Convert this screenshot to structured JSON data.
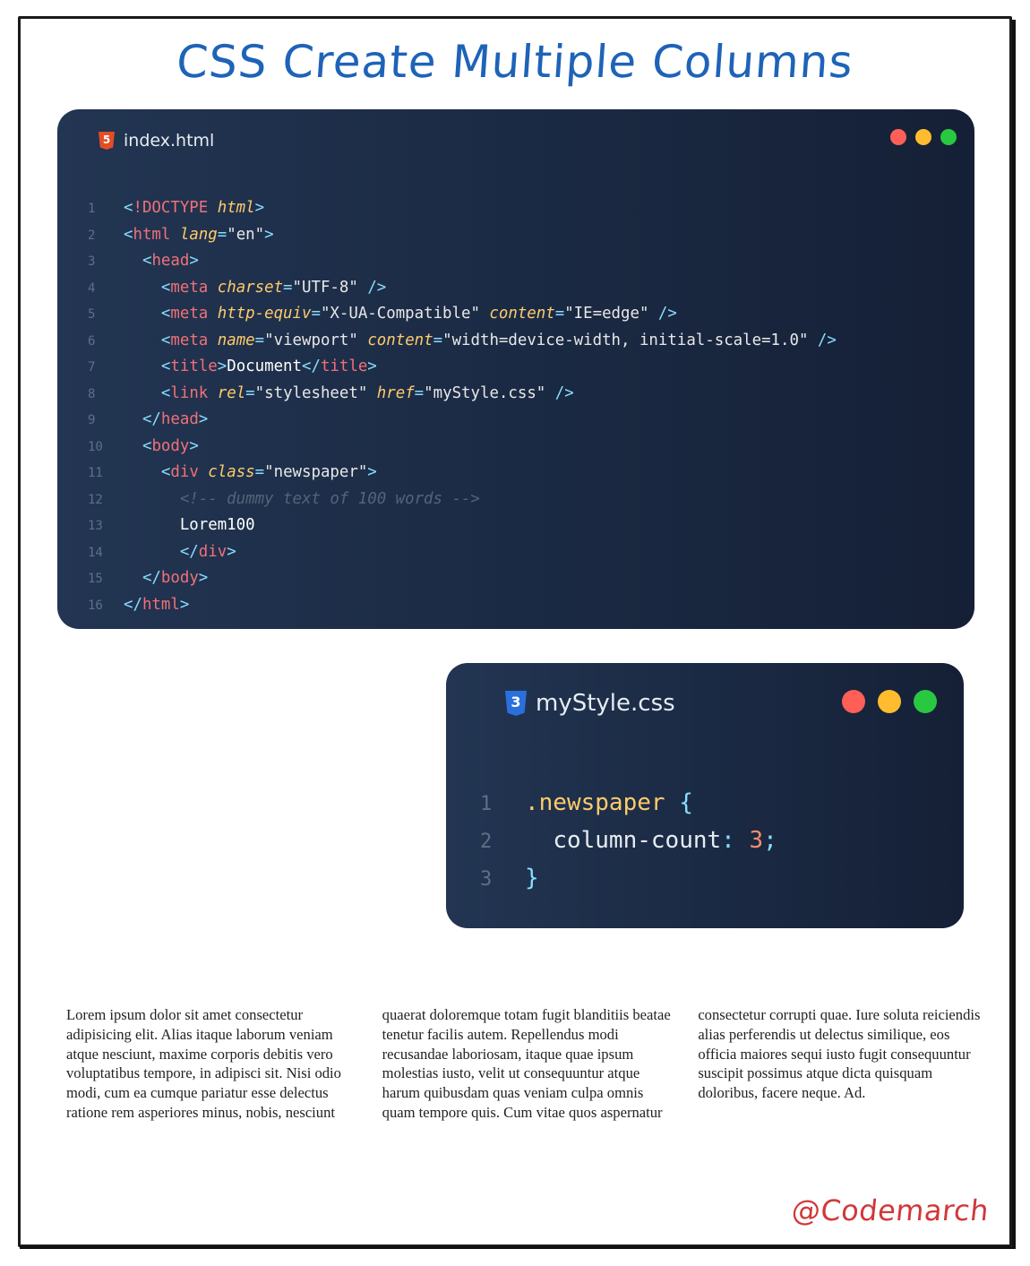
{
  "title": "CSS Create Multiple Columns",
  "html_window": {
    "filename": "index.html",
    "icon": "html5-icon",
    "lines": [
      {
        "n": "1",
        "indent": 0,
        "tokens": [
          [
            "punc",
            "<"
          ],
          [
            "tag",
            "!DOCTYPE"
          ],
          [
            "txt",
            " "
          ],
          [
            "attr",
            "html"
          ],
          [
            "punc",
            ">"
          ]
        ]
      },
      {
        "n": "2",
        "indent": 0,
        "tokens": [
          [
            "punc",
            "<"
          ],
          [
            "tag",
            "html"
          ],
          [
            "txt",
            " "
          ],
          [
            "attr",
            "lang"
          ],
          [
            "eq",
            "="
          ],
          [
            "str",
            "\"en\""
          ],
          [
            "punc",
            ">"
          ]
        ]
      },
      {
        "n": "3",
        "indent": 1,
        "tokens": [
          [
            "punc",
            "<"
          ],
          [
            "tag",
            "head"
          ],
          [
            "punc",
            ">"
          ]
        ]
      },
      {
        "n": "4",
        "indent": 2,
        "tokens": [
          [
            "punc",
            "<"
          ],
          [
            "tag",
            "meta"
          ],
          [
            "txt",
            " "
          ],
          [
            "attr",
            "charset"
          ],
          [
            "eq",
            "="
          ],
          [
            "str",
            "\"UTF-8\""
          ],
          [
            "txt",
            " "
          ],
          [
            "punc",
            "/>"
          ]
        ]
      },
      {
        "n": "5",
        "indent": 2,
        "tokens": [
          [
            "punc",
            "<"
          ],
          [
            "tag",
            "meta"
          ],
          [
            "txt",
            " "
          ],
          [
            "attr",
            "http-equiv"
          ],
          [
            "eq",
            "="
          ],
          [
            "str",
            "\"X-UA-Compatible\""
          ],
          [
            "txt",
            " "
          ],
          [
            "attr",
            "content"
          ],
          [
            "eq",
            "="
          ],
          [
            "str",
            "\"IE=edge\""
          ],
          [
            "txt",
            " "
          ],
          [
            "punc",
            "/>"
          ]
        ]
      },
      {
        "n": "6",
        "indent": 2,
        "tokens": [
          [
            "punc",
            "<"
          ],
          [
            "tag",
            "meta"
          ],
          [
            "txt",
            " "
          ],
          [
            "attr",
            "name"
          ],
          [
            "eq",
            "="
          ],
          [
            "str",
            "\"viewport\""
          ],
          [
            "txt",
            " "
          ],
          [
            "attr",
            "content"
          ],
          [
            "eq",
            "="
          ],
          [
            "str",
            "\"width=device-width, initial-scale=1.0\""
          ],
          [
            "txt",
            " "
          ],
          [
            "punc",
            "/>"
          ]
        ]
      },
      {
        "n": "7",
        "indent": 2,
        "tokens": [
          [
            "punc",
            "<"
          ],
          [
            "tag",
            "title"
          ],
          [
            "punc",
            ">"
          ],
          [
            "txt",
            "Document"
          ],
          [
            "punc",
            "</"
          ],
          [
            "tag",
            "title"
          ],
          [
            "punc",
            ">"
          ]
        ]
      },
      {
        "n": "8",
        "indent": 2,
        "tokens": [
          [
            "punc",
            "<"
          ],
          [
            "tag",
            "link"
          ],
          [
            "txt",
            " "
          ],
          [
            "attr",
            "rel"
          ],
          [
            "eq",
            "="
          ],
          [
            "str",
            "\"stylesheet\""
          ],
          [
            "txt",
            " "
          ],
          [
            "attr",
            "href"
          ],
          [
            "eq",
            "="
          ],
          [
            "str",
            "\"myStyle.css\""
          ],
          [
            "txt",
            " "
          ],
          [
            "punc",
            "/>"
          ]
        ]
      },
      {
        "n": "9",
        "indent": 1,
        "tokens": [
          [
            "punc",
            "</"
          ],
          [
            "tag",
            "head"
          ],
          [
            "punc",
            ">"
          ]
        ]
      },
      {
        "n": "10",
        "indent": 1,
        "tokens": [
          [
            "punc",
            "<"
          ],
          [
            "tag",
            "body"
          ],
          [
            "punc",
            ">"
          ]
        ]
      },
      {
        "n": "11",
        "indent": 2,
        "tokens": [
          [
            "punc",
            "<"
          ],
          [
            "tag",
            "div"
          ],
          [
            "txt",
            " "
          ],
          [
            "attr",
            "class"
          ],
          [
            "eq",
            "="
          ],
          [
            "str",
            "\"newspaper\""
          ],
          [
            "punc",
            ">"
          ]
        ]
      },
      {
        "n": "12",
        "indent": 3,
        "tokens": [
          [
            "com",
            "<!-- dummy text of 100 words -->"
          ]
        ]
      },
      {
        "n": "13",
        "indent": 3,
        "tokens": [
          [
            "txt",
            "Lorem100"
          ]
        ]
      },
      {
        "n": "14",
        "indent": 3,
        "tokens": [
          [
            "punc",
            "</"
          ],
          [
            "tag",
            "div"
          ],
          [
            "punc",
            ">"
          ]
        ]
      },
      {
        "n": "15",
        "indent": 1,
        "tokens": [
          [
            "punc",
            "</"
          ],
          [
            "tag",
            "body"
          ],
          [
            "punc",
            ">"
          ]
        ]
      },
      {
        "n": "16",
        "indent": 0,
        "tokens": [
          [
            "punc",
            "</"
          ],
          [
            "tag",
            "html"
          ],
          [
            "punc",
            ">"
          ]
        ]
      }
    ]
  },
  "css_window": {
    "filename": "myStyle.css",
    "icon": "css3-icon",
    "lines": [
      {
        "n": "1",
        "indent": 0,
        "tokens": [
          [
            "sel",
            ".newspaper"
          ],
          [
            "txt",
            " "
          ],
          [
            "punc",
            "{"
          ]
        ]
      },
      {
        "n": "2",
        "indent": 1,
        "tokens": [
          [
            "prop",
            "column-count"
          ],
          [
            "punc",
            ":"
          ],
          [
            "txt",
            " "
          ],
          [
            "num",
            "3"
          ],
          [
            "punc",
            ";"
          ]
        ]
      },
      {
        "n": "3",
        "indent": 0,
        "tokens": [
          [
            "punc",
            "}"
          ]
        ]
      }
    ]
  },
  "window_dot_colors": [
    "#ff5f57",
    "#febc2e",
    "#28c840"
  ],
  "output_text": "Lorem ipsum dolor sit amet consectetur adipisicing elit. Alias itaque laborum veniam atque nesciunt, maxime corporis debitis vero voluptatibus tempore, in adipisci sit. Nisi odio modi, cum ea cumque pariatur esse delectus ratione rem asperiores minus, nobis, nesciunt quaerat doloremque totam fugit blanditiis beatae tenetur facilis autem. Repellendus modi recusandae laboriosam, itaque quae ipsum molestias iusto, velit ut consequuntur atque harum quibusdam quas veniam culpa omnis quam tempore quis. Cum vitae quos aspernatur consectetur corrupti quae. Iure soluta reiciendis alias perferendis ut delectus similique, eos officia maiores sequi iusto fugit consequuntur suscipit possimus atque dicta quisquam doloribus, facere neque. Ad.",
  "signature": "@Codemarch",
  "colors": {
    "title": "#1e63b8",
    "signature": "#d1383a",
    "editor_bg": "#1b2a44"
  }
}
